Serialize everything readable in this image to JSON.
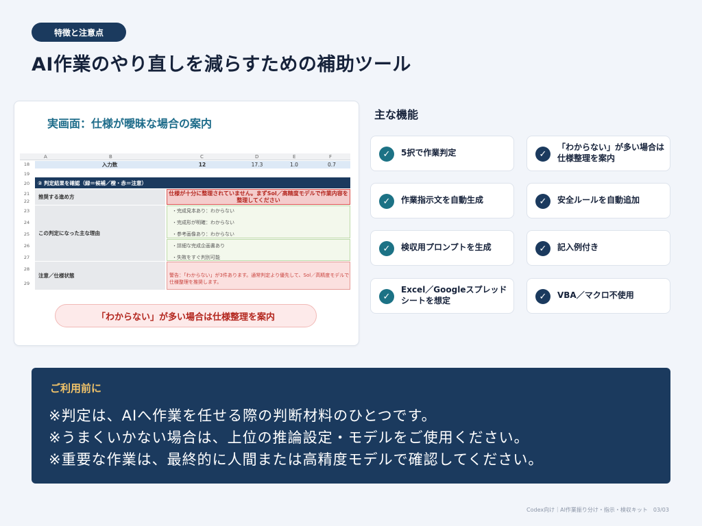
{
  "tag": "特徴と注意点",
  "title": "AI作業のやり直しを減らすための補助ツール",
  "screenshot": {
    "heading": "実画面：仕様が曖昧な場合の案内",
    "columns": [
      "A",
      "B",
      "C",
      "D",
      "E",
      "F"
    ],
    "rows": {
      "r18": {
        "num": "18",
        "label": "入力数",
        "c": "12",
        "d": "17.3",
        "e": "1.0",
        "f": "0.7"
      },
      "r19": {
        "num": "19"
      },
      "r20": {
        "num": "20",
        "text": "② 判定結果を確認（緑＝候補／橙・赤＝注意）"
      },
      "r21": {
        "num": "21"
      },
      "r22": {
        "num": "22"
      },
      "r23": {
        "num": "23"
      },
      "r24": {
        "num": "24"
      },
      "r25": {
        "num": "25"
      },
      "r26": {
        "num": "26"
      },
      "r27": {
        "num": "27"
      },
      "r28": {
        "num": "28"
      },
      "r29": {
        "num": "29"
      }
    },
    "recommend_label": "推奨する進め方",
    "recommend_value": "仕様が十分に整理されていません。まずSol／高精度モデルで作業内容を整理してください",
    "reason_label": "この判定になった主な理由",
    "reasons": [
      "・完成見本あり：わからない",
      "・完成形が明確：わからない",
      "・参考画像あり：わからない",
      "・詳細な完成企画書あり",
      "・失敗をすぐ判別可能"
    ],
    "status_label": "注意／仕様状態",
    "status_value": "警告：「わからない」が3件あります。通常判定より優先して、Sol／高精度モデルで仕様整理を推奨します。",
    "pill": "「わからない」が多い場合は仕様整理を案内"
  },
  "features": {
    "title": "主な機能",
    "items": [
      {
        "label": "5択で作業判定",
        "color": "#1c7285"
      },
      {
        "label": "「わからない」が多い場合は仕様整理を案内",
        "color": "#1b3a5e"
      },
      {
        "label": "作業指示文を自動生成",
        "color": "#1c7285"
      },
      {
        "label": "安全ルールを自動追加",
        "color": "#1b3a5e"
      },
      {
        "label": "検収用プロンプトを生成",
        "color": "#1c7285"
      },
      {
        "label": "記入例付き",
        "color": "#1b3a5e"
      },
      {
        "label": "Excel／Googleスプレッドシートを想定",
        "color": "#1c7285"
      },
      {
        "label": "VBA／マクロ不使用",
        "color": "#1b3a5e"
      }
    ]
  },
  "notice": {
    "heading": "ご利用前に",
    "lines": [
      "※判定は、AIへ作業を任せる際の判断材料のひとつです。",
      "※うまくいかない場合は、上位の推論設定・モデルをご使用ください。",
      "※重要な作業は、最終的に人間または高精度モデルで確認してください。"
    ]
  },
  "footer": "Codex向け｜AI作業振り分け・指示・検収キット　03/03"
}
